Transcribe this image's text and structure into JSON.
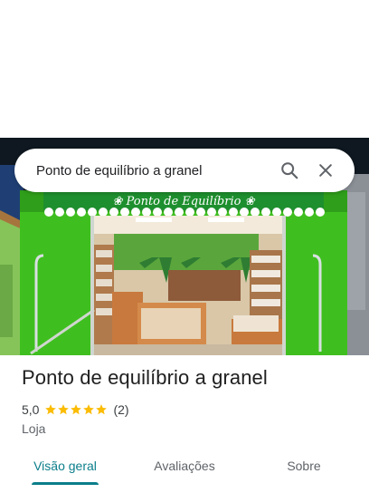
{
  "search": {
    "query": "Ponto de equilíbrio a granel"
  },
  "icons": {
    "search": "search-icon",
    "close": "close-icon",
    "star": "star-icon"
  },
  "photo": {
    "sign_text": "❀ Ponto de Equilíbrio ❀"
  },
  "place": {
    "name": "Ponto de equilíbrio a granel",
    "rating": "5,0",
    "stars": 5,
    "review_count": "(2)",
    "category": "Loja"
  },
  "tabs": [
    {
      "label": "Visão geral",
      "active": true
    },
    {
      "label": "Avaliações",
      "active": false
    },
    {
      "label": "Sobre",
      "active": false
    }
  ],
  "colors": {
    "accent": "#0b7e8a",
    "star": "#fbbc04",
    "storefront_green": "#3fbf1f"
  }
}
